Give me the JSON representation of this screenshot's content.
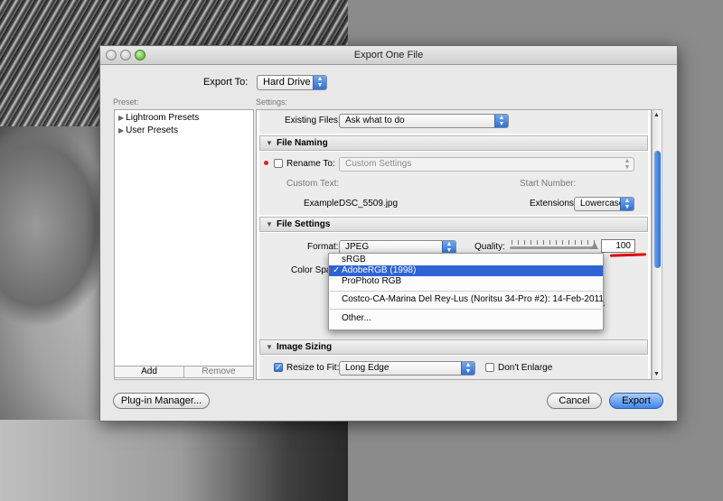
{
  "dialog": {
    "title": "Export One File",
    "export_to_label": "Export To:",
    "export_to_value": "Hard Drive",
    "preset_label": "Preset:",
    "settings_label": "Settings:"
  },
  "presets": {
    "items": [
      "Lightroom Presets",
      "User Presets"
    ],
    "add_label": "Add",
    "remove_label": "Remove"
  },
  "settings": {
    "existing_files_label": "Existing Files:",
    "existing_files_value": "Ask what to do",
    "file_naming": {
      "header": "File Naming",
      "rename_to_label": "Rename To:",
      "rename_to_value": "Custom Settings",
      "custom_text_label": "Custom Text:",
      "start_number_label": "Start Number:",
      "example_label": "Example:",
      "example_value": "DSC_5509.jpg",
      "extensions_label": "Extensions:",
      "extensions_value": "Lowercase"
    },
    "file_settings": {
      "header": "File Settings",
      "format_label": "Format:",
      "format_value": "JPEG",
      "quality_label": "Quality:",
      "quality_value": "100",
      "color_space_label": "Color Space"
    },
    "image_sizing": {
      "header": "Image Sizing",
      "resize_label": "Resize to Fit:",
      "resize_value": "Long Edge",
      "dont_enlarge_label": "Don't Enlarge"
    }
  },
  "color_space_menu": {
    "items": [
      "sRGB",
      "AdobeRGB (1998)",
      "ProPhoto RGB",
      "Costco-CA-Marina Del Rey-Lus  (Noritsu 34-Pro #2): 14-Feb-2011",
      "Other..."
    ],
    "selected_index": 1,
    "checkmark": "✓"
  },
  "buttons": {
    "plugin_manager": "Plug-in Manager...",
    "cancel": "Cancel",
    "export": "Export"
  },
  "partial_text": "s"
}
